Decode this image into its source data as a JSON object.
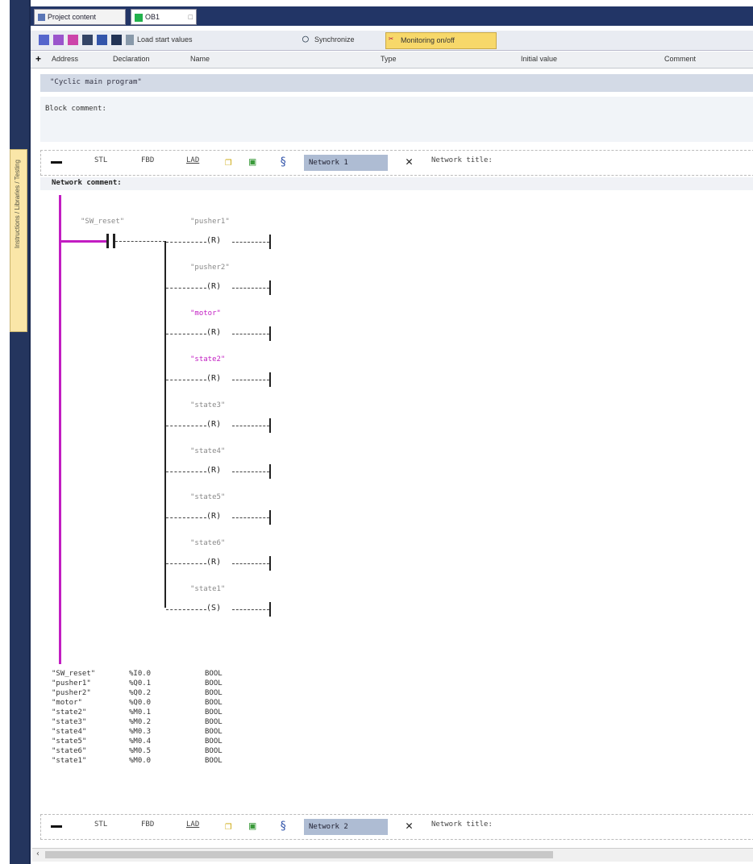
{
  "tabs": {
    "project": "Project content",
    "active": "OB1"
  },
  "left_panel": {
    "vertical_label": "Instructions / Libraries / Testing"
  },
  "toolbar": {
    "load_start": "Load start values",
    "synchronize": "Synchronize",
    "monitoring": "Monitoring on/off"
  },
  "columns": {
    "address": "Address",
    "declaration": "Declaration",
    "name": "Name",
    "type": "Type",
    "init": "Initial value",
    "comment": "Comment"
  },
  "block": {
    "title": "\"Cyclic main program\"",
    "comment": "Block comment:"
  },
  "network1": {
    "stl": "STL",
    "fbd": "FBD",
    "lad": "LAD",
    "label": "Network 1",
    "title": "Network title:",
    "comment": "Network comment:",
    "contact": "\"SW_reset\"",
    "coils": [
      {
        "tag": "\"pusher1\"",
        "op": "R"
      },
      {
        "tag": "\"pusher2\"",
        "op": "R"
      },
      {
        "tag": "\"motor\"",
        "op": "R"
      },
      {
        "tag": "\"state2\"",
        "op": "R"
      },
      {
        "tag": "\"state3\"",
        "op": "R"
      },
      {
        "tag": "\"state4\"",
        "op": "R"
      },
      {
        "tag": "\"state5\"",
        "op": "R"
      },
      {
        "tag": "\"state6\"",
        "op": "R"
      },
      {
        "tag": "\"state1\"",
        "op": "S"
      }
    ],
    "vars": [
      {
        "name": "\"SW_reset\"",
        "addr": "%I0.0",
        "type": "BOOL"
      },
      {
        "name": "\"pusher1\"",
        "addr": "%Q0.1",
        "type": "BOOL"
      },
      {
        "name": "\"pusher2\"",
        "addr": "%Q0.2",
        "type": "BOOL"
      },
      {
        "name": "\"motor\"",
        "addr": "%Q0.0",
        "type": "BOOL"
      },
      {
        "name": "\"state2\"",
        "addr": "%M0.1",
        "type": "BOOL"
      },
      {
        "name": "\"state3\"",
        "addr": "%M0.2",
        "type": "BOOL"
      },
      {
        "name": "\"state4\"",
        "addr": "%M0.3",
        "type": "BOOL"
      },
      {
        "name": "\"state5\"",
        "addr": "%M0.4",
        "type": "BOOL"
      },
      {
        "name": "\"state6\"",
        "addr": "%M0.5",
        "type": "BOOL"
      },
      {
        "name": "\"state1\"",
        "addr": "%M0.0",
        "type": "BOOL"
      }
    ]
  },
  "network2": {
    "stl": "STL",
    "fbd": "FBD",
    "lad": "LAD",
    "label": "Network 2",
    "title": "Network title:"
  },
  "colors": {
    "rail": "#c21dc2",
    "highlight_tag": "#c21dc2"
  }
}
